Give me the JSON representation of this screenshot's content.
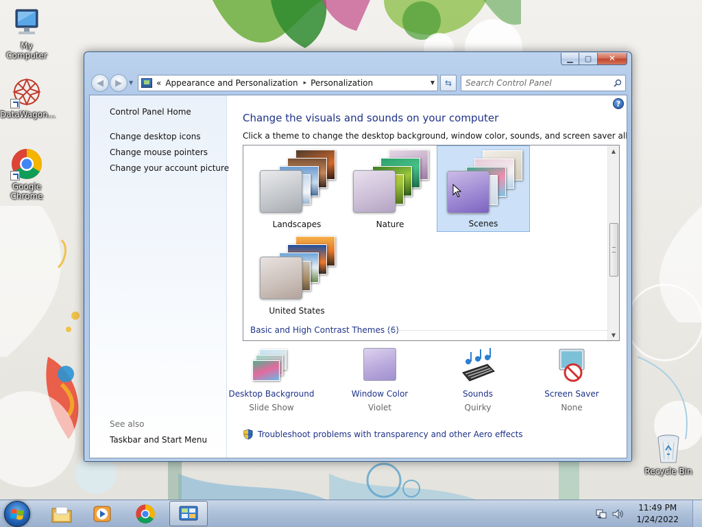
{
  "desktop": {
    "icons": [
      {
        "label": "My Computer",
        "icon": "computer-icon"
      },
      {
        "label": "DataWagon...",
        "icon": "datawagon-icon"
      },
      {
        "label": "Google Chrome",
        "icon": "chrome-icon"
      },
      {
        "label": "Recycle Bin",
        "icon": "recycle-bin-icon"
      }
    ]
  },
  "window": {
    "controls": {
      "minimize": "▁",
      "maximize": "▢",
      "close": "✕"
    },
    "address": {
      "overflow": "«",
      "segments": [
        "Appearance and Personalization",
        "Personalization"
      ],
      "separator": "▸",
      "dropdown": "▼"
    },
    "refresh_glyph": "⇆",
    "search": {
      "placeholder": "Search Control Panel"
    },
    "left_pane": {
      "home": "Control Panel Home",
      "links": [
        "Change desktop icons",
        "Change mouse pointers",
        "Change your account picture"
      ],
      "see_also_label": "See also",
      "see_also_links": [
        "Taskbar and Start Menu"
      ]
    },
    "main": {
      "help_glyph": "?",
      "title": "Change the visuals and sounds on your computer",
      "subtitle": "Click a theme to change the desktop background, window color, sounds, and screen saver all at once.",
      "themes": [
        {
          "label": "Landscapes",
          "selected": false
        },
        {
          "label": "Nature",
          "selected": false
        },
        {
          "label": "Scenes",
          "selected": true
        },
        {
          "label": "United States",
          "selected": false
        }
      ],
      "basic_themes_link": "Basic and High Contrast Themes (6)",
      "scroll_up": "▲",
      "scroll_down": "▼",
      "customize": [
        {
          "title": "Desktop Background",
          "value": "Slide Show",
          "icon": "desktop-background-icon"
        },
        {
          "title": "Window Color",
          "value": "Violet",
          "icon": "window-color-icon"
        },
        {
          "title": "Sounds",
          "value": "Quirky",
          "icon": "sounds-icon"
        },
        {
          "title": "Screen Saver",
          "value": "None",
          "icon": "screen-saver-icon"
        }
      ],
      "troubleshoot_link": "Troubleshoot problems with transparency and other Aero effects"
    }
  },
  "taskbar": {
    "items": [
      "start-button",
      "windows-explorer",
      "media-player",
      "google-chrome",
      "control-panel"
    ],
    "clock": {
      "time": "11:49 PM",
      "date": "1/24/2022"
    }
  },
  "colors": {
    "link": "#1e3287",
    "selection": "#cce1f8",
    "window_frame": "#a9c4e6"
  }
}
